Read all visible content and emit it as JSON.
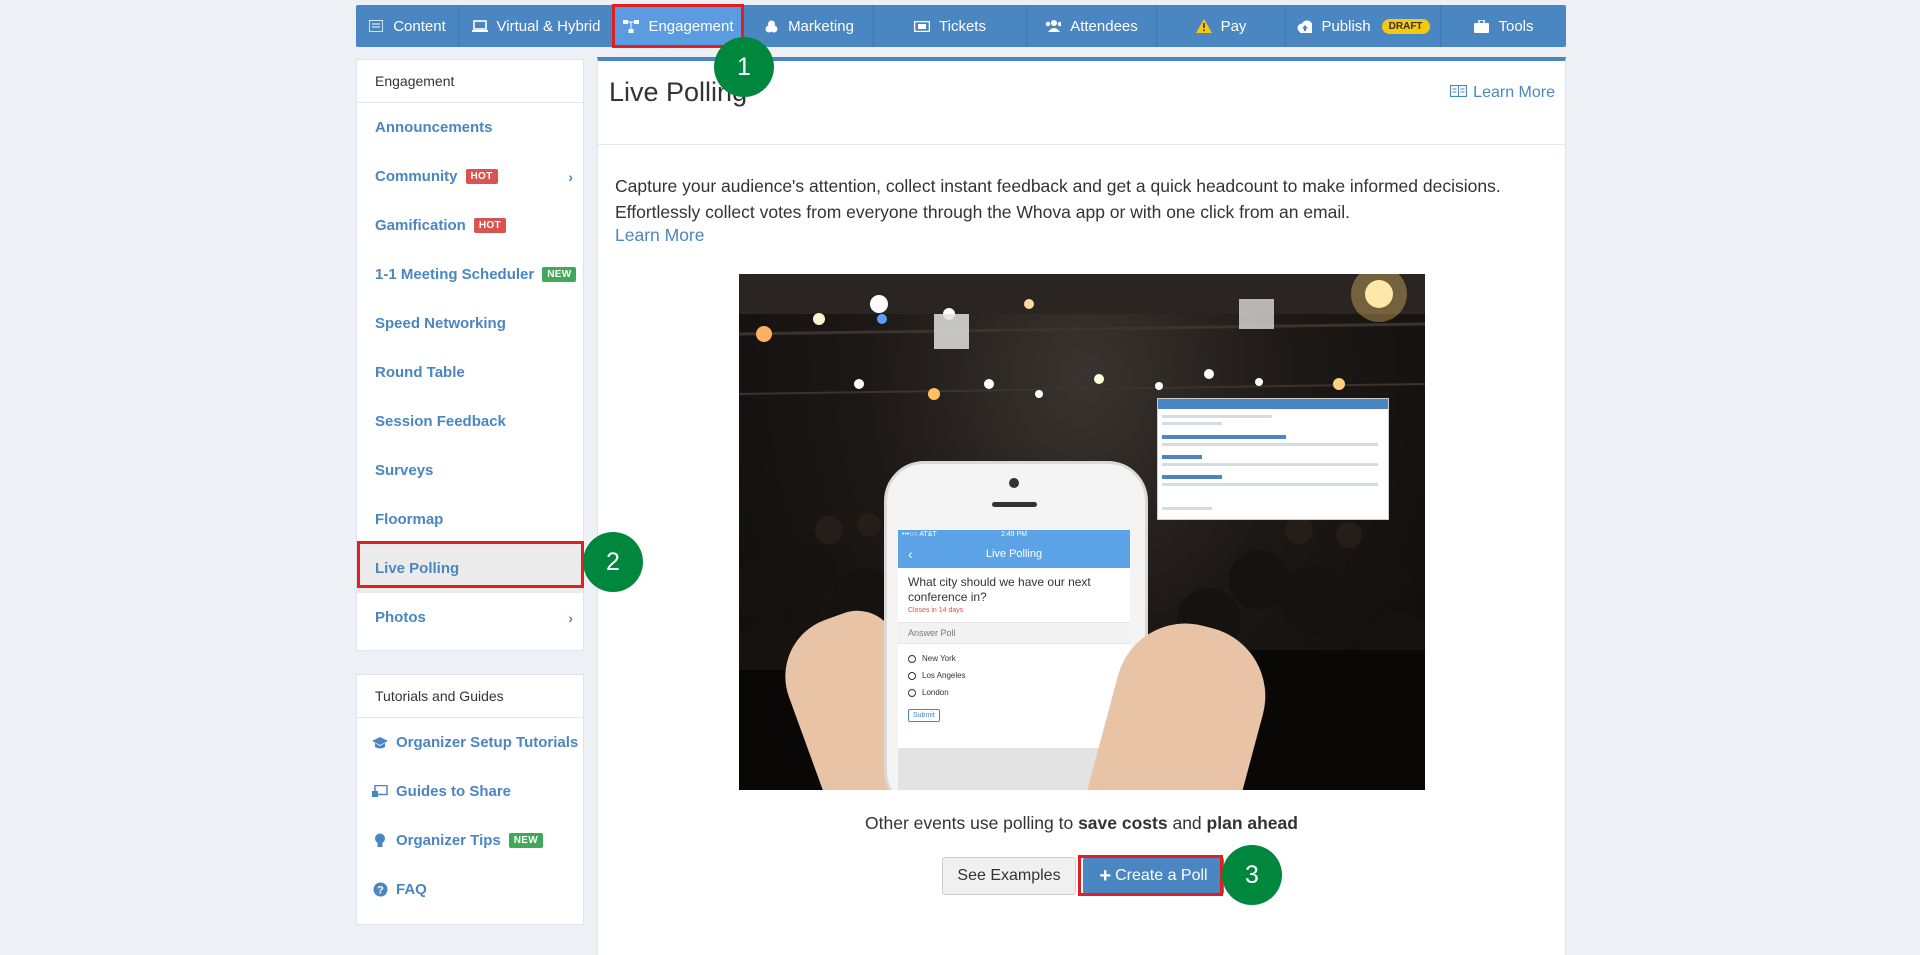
{
  "nav": {
    "items": [
      {
        "label": "Content",
        "icon": "list-icon"
      },
      {
        "label": "Virtual & Hybrid",
        "icon": "laptop-icon"
      },
      {
        "label": "Engagement",
        "icon": "sitemap-icon",
        "active": true
      },
      {
        "label": "Marketing",
        "icon": "bullhorn-icon"
      },
      {
        "label": "Tickets",
        "icon": "ticket-icon"
      },
      {
        "label": "Attendees",
        "icon": "users-icon"
      },
      {
        "label": "Pay",
        "icon": "warning-icon"
      },
      {
        "label": "Publish",
        "icon": "cloud-upload-icon",
        "badge": "DRAFT"
      },
      {
        "label": "Tools",
        "icon": "briefcase-icon"
      }
    ]
  },
  "sidebar": {
    "heading": "Engagement",
    "items": [
      {
        "label": "Announcements"
      },
      {
        "label": "Community",
        "tag": "HOT",
        "chevron": true
      },
      {
        "label": "Gamification",
        "tag": "HOT"
      },
      {
        "label": "1-1 Meeting Scheduler",
        "tag": "NEW"
      },
      {
        "label": "Speed Networking"
      },
      {
        "label": "Round Table"
      },
      {
        "label": "Session Feedback"
      },
      {
        "label": "Surveys"
      },
      {
        "label": "Floormap"
      },
      {
        "label": "Live Polling",
        "selected": true
      },
      {
        "label": "Photos",
        "chevron": true
      }
    ]
  },
  "guides": {
    "heading": "Tutorials and Guides",
    "items": [
      {
        "label": "Organizer Setup Tutorials",
        "icon": "graduation-cap-icon"
      },
      {
        "label": "Guides to Share",
        "icon": "share-screen-icon"
      },
      {
        "label": "Organizer Tips",
        "icon": "lightbulb-icon",
        "tag": "NEW"
      },
      {
        "label": "FAQ",
        "icon": "question-circle-icon"
      }
    ]
  },
  "main": {
    "title": "Live Polling",
    "learn_more_top": "Learn More",
    "description_1": "Capture your audience's attention, collect instant feedback and get a quick headcount to make informed decisions.",
    "description_2": "Effortlessly collect votes from everyone through the Whova app or with one click from an email.",
    "learn_more_link": "Learn More",
    "other_prefix": "Other events use polling to ",
    "other_bold_1": "save costs",
    "other_mid": " and ",
    "other_bold_2": "plan ahead",
    "see_examples": "See Examples",
    "create_poll": "Create a Poll"
  },
  "phone": {
    "status": "2:49 PM",
    "carrier": "•••○○ AT&T",
    "header": "Live Polling",
    "question": "What city should we have our next conference in?",
    "closes": "Closes in 14 days",
    "answer_label": "Answer Poll",
    "options": [
      "New York",
      "Los Angeles",
      "London"
    ],
    "submit": "Submit"
  },
  "steps": [
    "1",
    "2",
    "3"
  ],
  "colors": {
    "brand": "#4a86c1",
    "highlight": "#e02020",
    "step": "#00873e",
    "hot": "#d9534f",
    "new": "#3fa85a",
    "draft": "#f6c90e"
  }
}
